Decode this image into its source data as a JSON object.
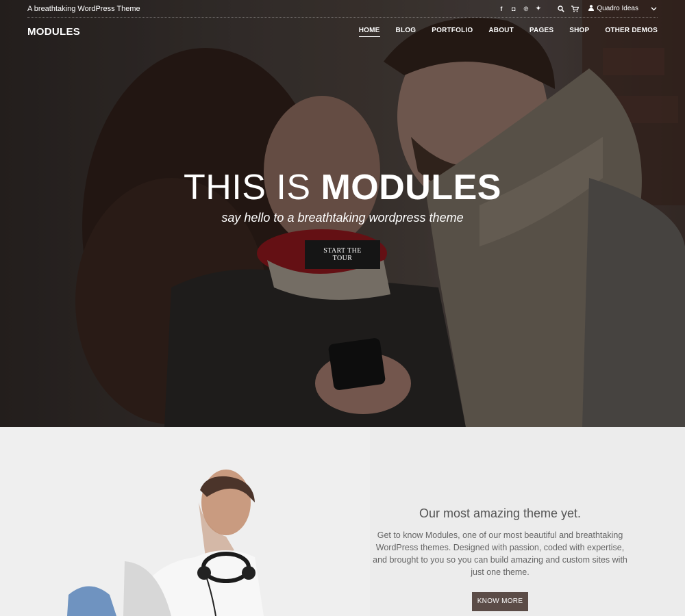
{
  "topbar": {
    "tagline": "A breathtaking WordPress Theme",
    "social": [
      {
        "icon": "facebook-icon",
        "glyph": "f"
      },
      {
        "icon": "instagram-icon",
        "glyph": "◘"
      },
      {
        "icon": "pinterest-icon",
        "glyph": "℗"
      },
      {
        "icon": "twitter-icon",
        "glyph": "✦"
      }
    ],
    "user_name": "Quadro Ideas"
  },
  "nav": {
    "logo": "MODULES",
    "items": [
      "HOME",
      "BLOG",
      "PORTFOLIO",
      "ABOUT",
      "PAGES",
      "SHOP",
      "OTHER DEMOS"
    ],
    "active": "HOME"
  },
  "hero": {
    "title_light": "THIS IS",
    "title_bold": "MODULES",
    "subtitle": "say hello to a breathtaking wordpress theme",
    "button": "START THE TOUR"
  },
  "promo": {
    "title": "Our most amazing theme yet.",
    "body": "Get to know Modules, one of our most beautiful and breathtaking WordPress themes. Designed with passion, coded with expertise, and brought to you so you can build amazing and custom sites with just one theme.",
    "button": "KNOW MORE"
  },
  "colors": {
    "tour_button_bg": "#151515",
    "know_more_bg": "#5b4c47",
    "section_bg": "#ececec"
  }
}
